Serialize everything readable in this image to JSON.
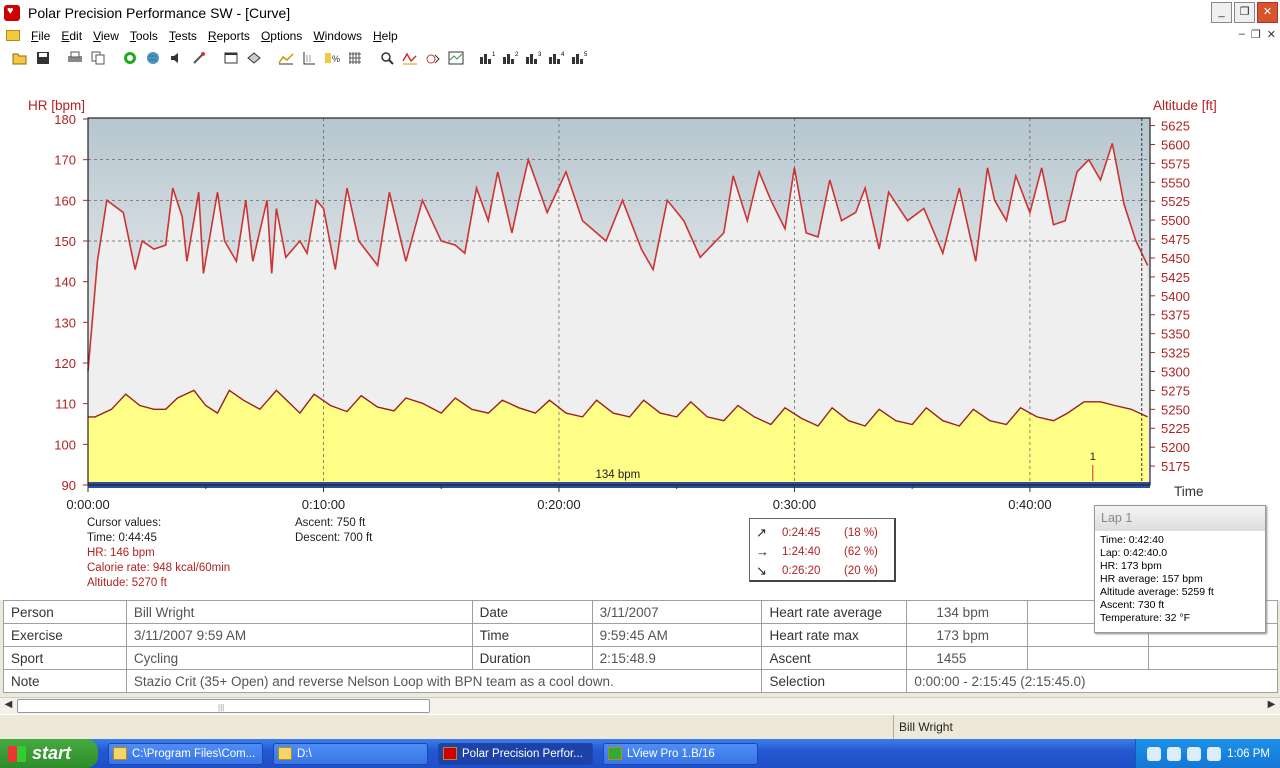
{
  "window": {
    "title": "Polar Precision Performance SW - [Curve]",
    "minimize": "_",
    "restore": "❐",
    "close": "✕"
  },
  "menu": [
    "File",
    "Edit",
    "View",
    "Tools",
    "Tests",
    "Reports",
    "Options",
    "Windows",
    "Help"
  ],
  "mdi": {
    "minimize": "–",
    "restore": "❐",
    "close": "✕"
  },
  "toolbar_icons": [
    "open-icon",
    "save-icon",
    "print-icon",
    "copy-icon",
    "sync-icon",
    "globe-icon",
    "sound-icon",
    "tool-icon",
    "window-icon",
    "book-icon",
    "curve-icon",
    "axis-icon",
    "percent-icon",
    "grid-icon",
    "zoom-icon",
    "hr-curve-icon",
    "speed-icon",
    "graph-icon",
    "bars1-icon",
    "bars2-icon",
    "bars3-icon",
    "bars4-icon",
    "bars5-icon"
  ],
  "chart": {
    "y_left_title": "HR [bpm]",
    "y_right_title": "Altitude [ft]",
    "x_title": "Time",
    "avg_label": "134 bpm",
    "lap_marker": "1",
    "y_left_ticks": [
      "180",
      "170",
      "160",
      "150",
      "140",
      "130",
      "120",
      "110",
      "100",
      "90"
    ],
    "y_right_ticks": [
      "5625",
      "5600",
      "5575",
      "5550",
      "5525",
      "5500",
      "5475",
      "5450",
      "5425",
      "5400",
      "5375",
      "5350",
      "5325",
      "5300",
      "5275",
      "5250",
      "5225",
      "5200",
      "5175"
    ],
    "x_ticks": [
      "0:00:00",
      "0:10:00",
      "0:20:00",
      "0:30:00",
      "0:40:00"
    ]
  },
  "chart_data": {
    "type": "line",
    "title": "",
    "xlabel": "Time",
    "ylabel": "HR [bpm]",
    "y2label": "Altitude [ft]",
    "ylim": [
      90,
      180
    ],
    "y2lim": [
      5150,
      5635
    ],
    "xlim_min": [
      0,
      45
    ],
    "series": [
      {
        "name": "HR [bpm]",
        "axis": "left",
        "color": "#cc3333",
        "x": [
          0,
          0.4,
          0.8,
          1.5,
          2.0,
          2.3,
          2.8,
          3.3,
          3.6,
          4.0,
          4.2,
          4.7,
          4.9,
          5.5,
          5.8,
          6.3,
          6.7,
          7.0,
          7.6,
          7.8,
          8.0,
          8.4,
          9.0,
          9.3,
          9.7,
          10.0,
          10.5,
          11.0,
          11.5,
          12.3,
          12.8,
          13.5,
          14.2,
          15.0,
          15.6,
          16.0,
          16.5,
          17.0,
          17.4,
          18.0,
          18.3,
          18.7,
          19.5,
          20.3,
          21.0,
          22.0,
          22.7,
          23.5,
          24.0,
          24.6,
          25.3,
          26.0,
          26.5,
          27.0,
          27.4,
          28.0,
          28.5,
          29.0,
          29.6,
          30.0,
          30.5,
          31.0,
          31.5,
          32.0,
          32.6,
          33.0,
          33.6,
          34.0,
          34.8,
          35.5,
          36.3,
          37.0,
          37.7,
          38.2,
          38.5,
          39.0,
          39.4,
          40.0,
          40.5,
          41.0,
          41.5,
          42.0,
          42.5,
          43.0,
          43.5,
          44.0,
          44.5,
          45.0
        ],
        "values": [
          118,
          145,
          160,
          157,
          143,
          150,
          148,
          149,
          163,
          156,
          145,
          162,
          142,
          162,
          150,
          145,
          160,
          145,
          160,
          142,
          158,
          146,
          150,
          147,
          160,
          158,
          143,
          163,
          150,
          144,
          162,
          145,
          160,
          150,
          149,
          147,
          163,
          155,
          167,
          152,
          160,
          170,
          157,
          167,
          155,
          150,
          160,
          148,
          143,
          160,
          155,
          146,
          149,
          152,
          166,
          155,
          167,
          160,
          153,
          168,
          152,
          151,
          165,
          155,
          157,
          163,
          148,
          162,
          155,
          158,
          147,
          163,
          145,
          168,
          160,
          155,
          166,
          157,
          168,
          154,
          155,
          167,
          170,
          165,
          174,
          159,
          150,
          144
        ]
      },
      {
        "name": "Altitude [ft]",
        "axis": "right",
        "color": "#9b2020",
        "x": [
          0,
          0.3,
          1.0,
          1.6,
          2.2,
          2.8,
          3.3,
          3.8,
          4.5,
          5.0,
          5.5,
          6.0,
          6.6,
          7.3,
          8.0,
          8.5,
          9.0,
          9.6,
          10.3,
          11.0,
          11.6,
          12.3,
          13.0,
          13.5,
          14.2,
          15.0,
          15.6,
          16.3,
          17.0,
          17.6,
          18.3,
          19.0,
          19.6,
          20.3,
          21.0,
          21.6,
          22.3,
          23.0,
          23.6,
          24.3,
          25.0,
          25.6,
          26.3,
          27.0,
          27.6,
          28.3,
          29.0,
          29.6,
          30.3,
          31.0,
          31.6,
          32.3,
          33.0,
          33.6,
          34.3,
          35.0,
          35.6,
          36.3,
          37.0,
          37.6,
          38.3,
          39.0,
          39.6,
          40.3,
          41.0,
          41.6,
          42.3,
          43.0,
          43.6,
          44.3,
          45.0
        ],
        "values": [
          5240,
          5240,
          5250,
          5270,
          5255,
          5250,
          5250,
          5265,
          5275,
          5255,
          5245,
          5275,
          5262,
          5250,
          5275,
          5260,
          5245,
          5270,
          5255,
          5247,
          5268,
          5253,
          5248,
          5265,
          5258,
          5245,
          5265,
          5250,
          5245,
          5262,
          5252,
          5245,
          5262,
          5245,
          5240,
          5262,
          5245,
          5240,
          5262,
          5245,
          5240,
          5260,
          5240,
          5235,
          5255,
          5240,
          5230,
          5252,
          5238,
          5228,
          5252,
          5235,
          5228,
          5250,
          5235,
          5230,
          5252,
          5235,
          5228,
          5250,
          5235,
          5230,
          5252,
          5240,
          5235,
          5245,
          5260,
          5260,
          5255,
          5250,
          5240
        ]
      }
    ],
    "average_hr": 134,
    "grid": true
  },
  "cursor_values": {
    "title": "Cursor values:",
    "time": "Time: 0:44:45",
    "hr": "HR: 146 bpm",
    "calorie": "Calorie rate: 948 kcal/60min",
    "altitude": "Altitude: 5270 ft"
  },
  "ascent_info": {
    "ascent": "Ascent: 750 ft",
    "descent": "Descent: 700 ft"
  },
  "slopes": [
    {
      "arrow": "↗",
      "time": "0:24:45",
      "pct": "(18 %)"
    },
    {
      "arrow": "→",
      "time": "1:24:40",
      "pct": "(62 %)"
    },
    {
      "arrow": "↘",
      "time": "0:26:20",
      "pct": "(20 %)"
    }
  ],
  "lap_popup": {
    "title": "Lap 1",
    "time": "Time: 0:42:40",
    "lap": "Lap: 0:42:40.0",
    "hr": "HR: 173 bpm",
    "hr_avg": "HR average:  157 bpm",
    "alt_avg": "Altitude average:  5259 ft",
    "ascent": "Ascent:  730 ft",
    "temp": "Temperature: 32 °F"
  },
  "info": {
    "person_label": "Person",
    "person": "Bill Wright",
    "date_label": "Date",
    "date": "3/11/2007",
    "hr_avg_label": "Heart rate average",
    "hr_avg": "134 bpm",
    "exercise_label": "Exercise",
    "exercise": "3/11/2007 9:59 AM",
    "time_label": "Time",
    "time": "9:59:45 AM",
    "hr_max_label": "Heart rate max",
    "hr_max": "173 bpm",
    "sport_label": "Sport",
    "sport": "Cycling",
    "duration_label": "Duration",
    "duration": "2:15:48.9",
    "ascent_label": "Ascent",
    "ascent": "1455",
    "note_label": "Note",
    "note": "Stazio Crit (35+ Open) and reverse Nelson Loop with BPN team as a cool down.",
    "selection_label": "Selection",
    "selection": "0:00:00 - 2:15:45 (2:15:45.0)"
  },
  "status": {
    "user": "Bill Wright"
  },
  "taskbar": {
    "start": "start",
    "tasks": [
      "C:\\Program Files\\Com...",
      "D:\\",
      "Polar Precision Perfor...",
      "LView Pro 1.B/16"
    ],
    "clock": "1:06 PM"
  }
}
